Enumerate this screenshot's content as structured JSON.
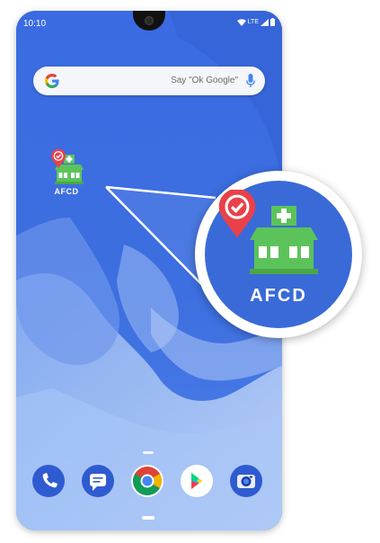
{
  "status_bar": {
    "time": "10:10",
    "network": "LTE"
  },
  "search_bar": {
    "hint": "Say \"Ok Google\"",
    "logo_icon": "google-g-icon",
    "mic_icon": "mic-icon"
  },
  "home_app": {
    "label": "AFCD",
    "icon": "clinic-building-icon",
    "badge_icon": "location-pin-check-icon",
    "badge_color": "#e8414a",
    "building_color": "#5cc35a"
  },
  "magnified_app": {
    "label": "AFCD"
  },
  "dock": {
    "apps": [
      {
        "name": "Phone",
        "icon": "phone-icon"
      },
      {
        "name": "Messages",
        "icon": "messages-icon"
      },
      {
        "name": "Chrome",
        "icon": "chrome-icon"
      },
      {
        "name": "Play Store",
        "icon": "play-store-icon"
      },
      {
        "name": "Camera",
        "icon": "camera-icon"
      }
    ]
  },
  "colors": {
    "wallpaper_blue": "#3d6fe0",
    "accent_red": "#e8414a",
    "accent_green": "#5cc35a"
  }
}
